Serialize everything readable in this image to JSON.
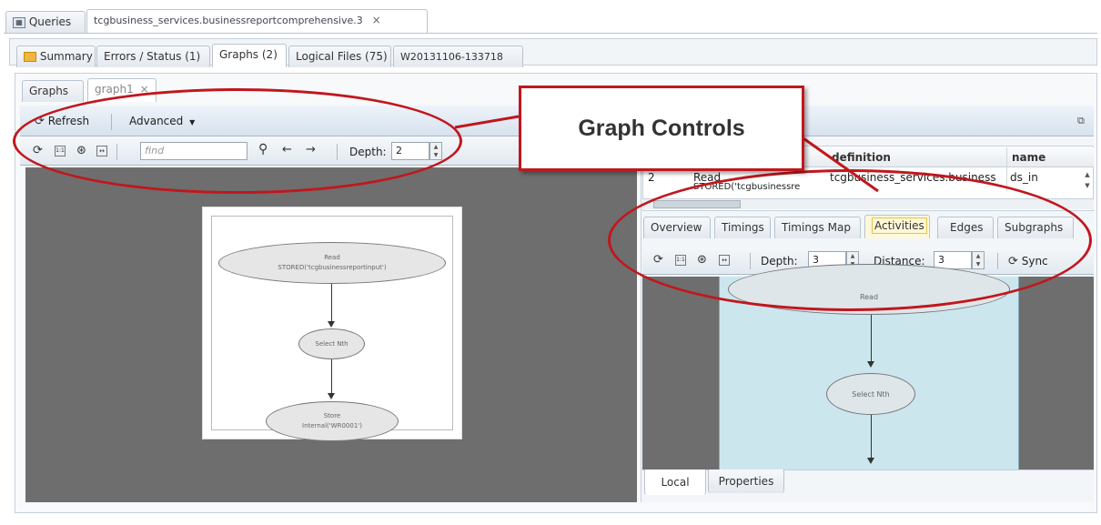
{
  "top_tabs": {
    "queries_label": "Queries",
    "wu_tab_label": "tcgbusiness_services.businessreportcomprehensive.3",
    "close_glyph": "×"
  },
  "wu_tabs": [
    {
      "label": "Summary"
    },
    {
      "label": "Errors / Status (1)"
    },
    {
      "label": "Graphs (2)"
    },
    {
      "label": "Logical Files (75)"
    },
    {
      "label": "W20131106-133718"
    }
  ],
  "graph_tabs": {
    "graphs_label": "Graphs",
    "graph1_label": "graph1",
    "close_glyph": "×"
  },
  "toolbar": {
    "refresh_label": "Refresh",
    "advanced_label": "Advanced",
    "find_placeholder": "find",
    "depth_label": "Depth:",
    "depth_value": "2"
  },
  "main_graph": {
    "node1_title": "Read",
    "node1_sub": "STORED('tcgbusinessreportinput')",
    "node2_title": "Select Nth",
    "node3_title": "Store",
    "node3_sub": "Internal('WR0001')"
  },
  "table": {
    "col_definition": "definition",
    "col_name": "name",
    "row_id": "2",
    "row_label": "Read",
    "row_label2": "STORED('tcgbusinessre",
    "row_definition": "tcgbusiness_services.business",
    "row_name": "ds_in"
  },
  "right_tabs": [
    {
      "label": "Overview"
    },
    {
      "label": "Timings"
    },
    {
      "label": "Timings Map"
    },
    {
      "label": "Activities"
    },
    {
      "label": "Edges"
    },
    {
      "label": "Subgraphs"
    }
  ],
  "right_toolbar": {
    "depth_label": "Depth:",
    "depth_value": "3",
    "distance_label": "Distance:",
    "distance_value": "3",
    "sync_label": "Sync"
  },
  "local_graph": {
    "node1_title": "Read",
    "node2_title": "Select Nth"
  },
  "bottom_tabs": {
    "local_label": "Local",
    "properties_label": "Properties"
  },
  "callout": {
    "text": "Graph Controls"
  },
  "colors": {
    "callout_red": "#c0171d",
    "graph_bg": "#6e6e6e",
    "local_graph_bg": "#cce6ee"
  }
}
